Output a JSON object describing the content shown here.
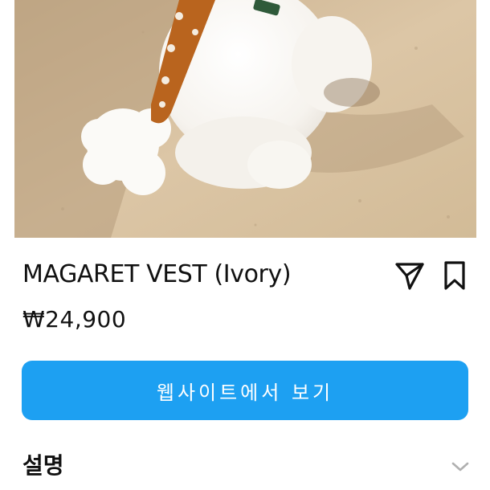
{
  "product": {
    "title": "MAGARET VEST (Ivory)",
    "price": "₩24,900",
    "photo_alt": "white dog wearing a brown dotted vest"
  },
  "actions": {
    "share_icon": "paper-plane-icon",
    "bookmark_icon": "bookmark-icon",
    "website_button_label": "웹사이트에서 보기"
  },
  "description": {
    "section_title": "설명",
    "expand_icon": "chevron-down-icon"
  },
  "colors": {
    "cta": "#1da0f2",
    "text": "#111111",
    "chevron": "#b0b0b0"
  }
}
